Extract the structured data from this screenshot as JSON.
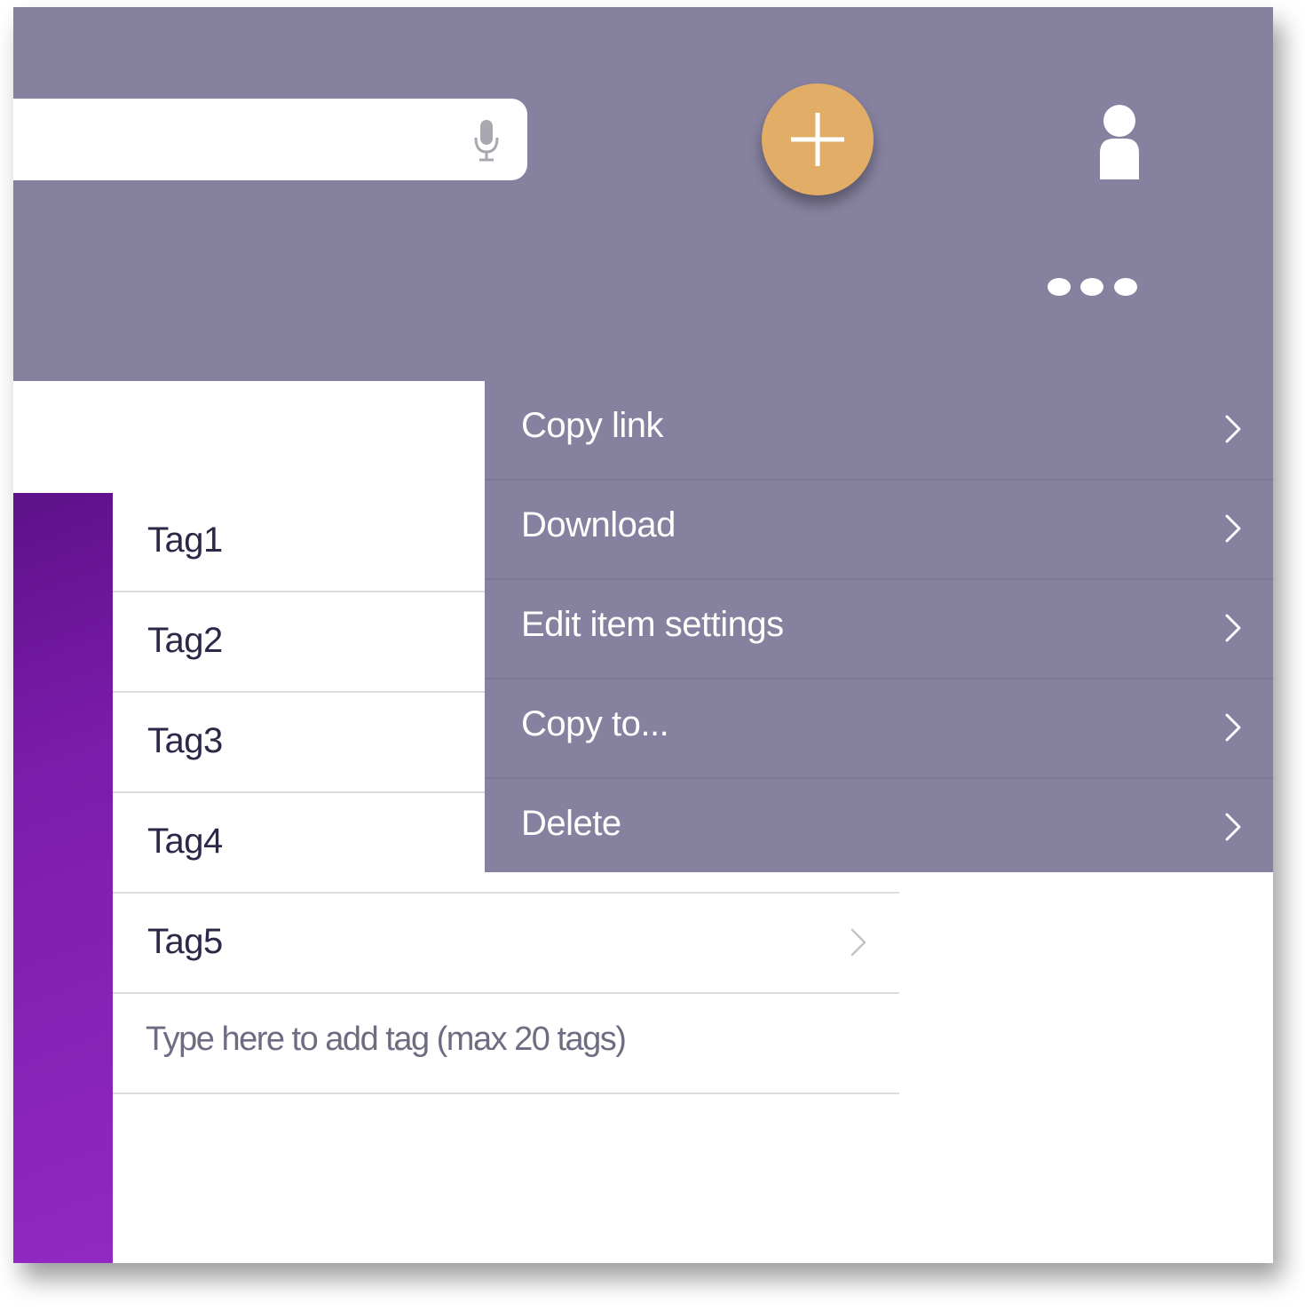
{
  "header": {
    "search": {
      "placeholder": "",
      "mic_icon": "microphone-icon"
    },
    "add_button_icon": "plus-icon",
    "profile_icon": "user-icon",
    "more_icon": "more-horizontal-icon"
  },
  "colors": {
    "header_bg": "#85819f",
    "add_button": "#e2ad66",
    "sidebar_gradient_start": "#5d1188",
    "sidebar_gradient_end": "#9128c2",
    "menu_bg": "#85819f",
    "tag_text": "#2c2848"
  },
  "tags": [
    {
      "label": "Tag1"
    },
    {
      "label": "Tag2"
    },
    {
      "label": "Tag3"
    },
    {
      "label": "Tag4"
    },
    {
      "label": "Tag5"
    }
  ],
  "add_tag": {
    "placeholder": "Type here to add tag (max 20 tags)"
  },
  "context_menu": {
    "items": [
      {
        "label": "Copy link",
        "icon": "chevron-right-icon"
      },
      {
        "label": "Download",
        "icon": "chevron-right-icon"
      },
      {
        "label": "Edit item settings",
        "icon": "chevron-right-icon"
      },
      {
        "label": "Copy to...",
        "icon": "chevron-right-icon"
      },
      {
        "label": "Delete",
        "icon": "chevron-right-icon"
      }
    ]
  }
}
